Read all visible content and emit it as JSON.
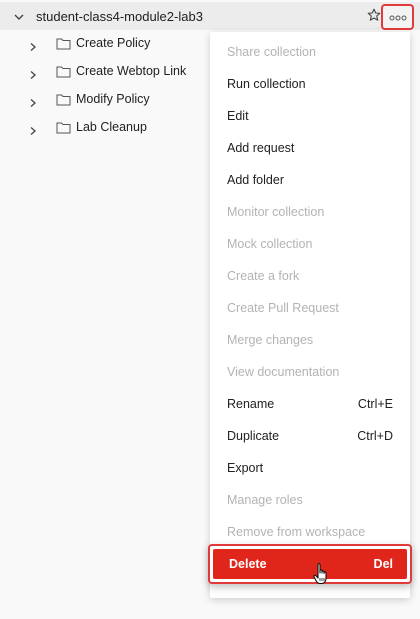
{
  "collection": {
    "name": "student-class4-module2-lab3",
    "expand_icon": "chevron-down-icon",
    "favorite_icon": "star-icon",
    "more_icon": "more-horizontal-icon"
  },
  "tree": {
    "items": [
      {
        "label": "Create Policy",
        "icon": "folder-icon"
      },
      {
        "label": "Create Webtop Link",
        "icon": "folder-icon"
      },
      {
        "label": "Modify Policy",
        "icon": "folder-icon"
      },
      {
        "label": "Lab Cleanup",
        "icon": "folder-icon"
      }
    ]
  },
  "context_menu": {
    "items": [
      {
        "label": "Share collection",
        "shortcut": "",
        "enabled": false
      },
      {
        "label": "Run collection",
        "shortcut": "",
        "enabled": true
      },
      {
        "label": "Edit",
        "shortcut": "",
        "enabled": true
      },
      {
        "label": "Add request",
        "shortcut": "",
        "enabled": true
      },
      {
        "label": "Add folder",
        "shortcut": "",
        "enabled": true
      },
      {
        "label": "Monitor collection",
        "shortcut": "",
        "enabled": false
      },
      {
        "label": "Mock collection",
        "shortcut": "",
        "enabled": false
      },
      {
        "label": "Create a fork",
        "shortcut": "",
        "enabled": false
      },
      {
        "label": "Create Pull Request",
        "shortcut": "",
        "enabled": false
      },
      {
        "label": "Merge changes",
        "shortcut": "",
        "enabled": false
      },
      {
        "label": "View documentation",
        "shortcut": "",
        "enabled": false
      },
      {
        "label": "Rename",
        "shortcut": "Ctrl+E",
        "enabled": true
      },
      {
        "label": "Duplicate",
        "shortcut": "Ctrl+D",
        "enabled": true
      },
      {
        "label": "Export",
        "shortcut": "",
        "enabled": true
      },
      {
        "label": "Manage roles",
        "shortcut": "",
        "enabled": false
      },
      {
        "label": "Remove from workspace",
        "shortcut": "",
        "enabled": false
      }
    ],
    "delete": {
      "label": "Delete",
      "shortcut": "Del",
      "highlighted": true
    }
  },
  "colors": {
    "highlight_border": "#e23a3a",
    "delete_background": "#e0251b",
    "disabled_text": "#b3b3b3"
  }
}
